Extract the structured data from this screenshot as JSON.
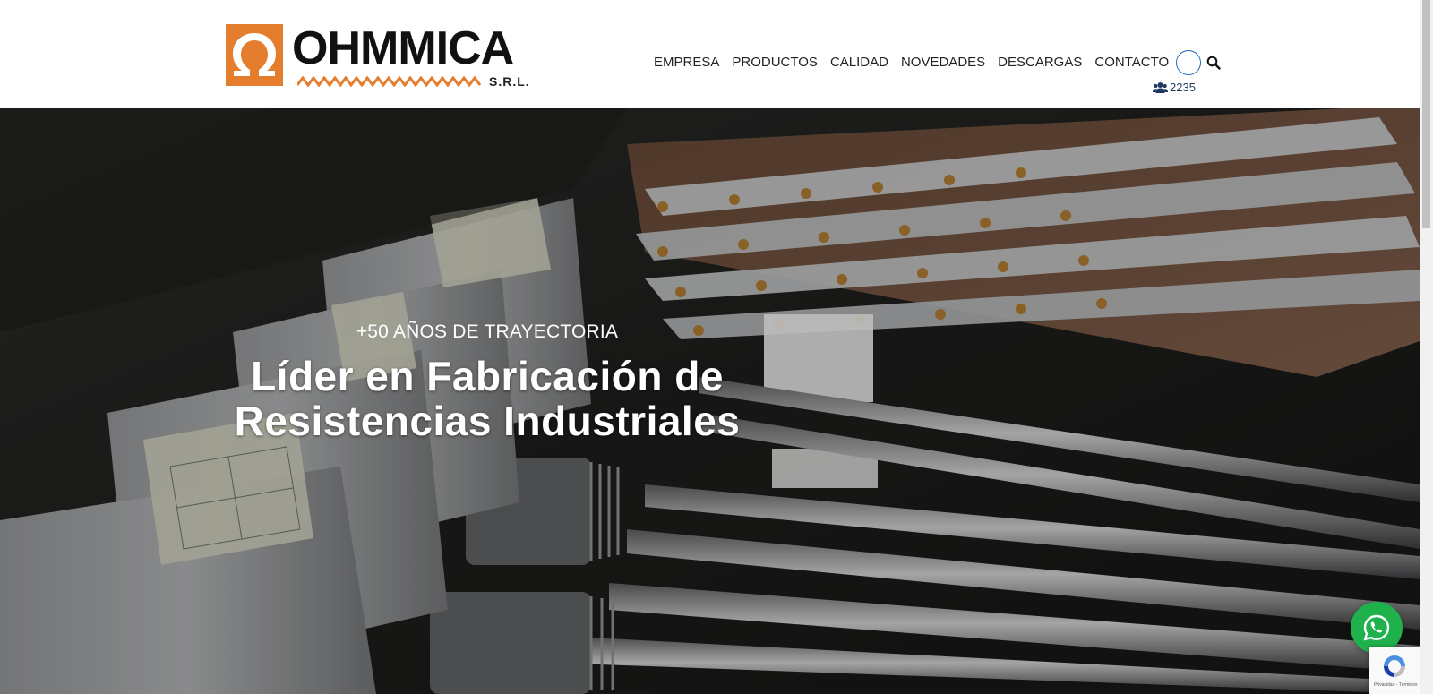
{
  "brand": {
    "name": "OHMMICA",
    "suffix": "S.R.L.",
    "accent_color": "#e57d2f"
  },
  "nav": {
    "items": [
      "EMPRESA",
      "PRODUCTOS",
      "CALIDAD",
      "NOVEDADES",
      "DESCARGAS",
      "CONTACTO"
    ],
    "search_icon": "search-icon"
  },
  "visitors": {
    "icon": "users-icon",
    "count": "2235"
  },
  "hero": {
    "eyebrow": "+50 AÑOS DE TRAYECTORIA",
    "title": "Líder en Fabricación de Resistencias Industriales"
  },
  "widgets": {
    "whatsapp_icon": "whatsapp-icon",
    "whatsapp_color": "#1fb14b",
    "recaptcha_text": "Privacidad - Términos"
  }
}
